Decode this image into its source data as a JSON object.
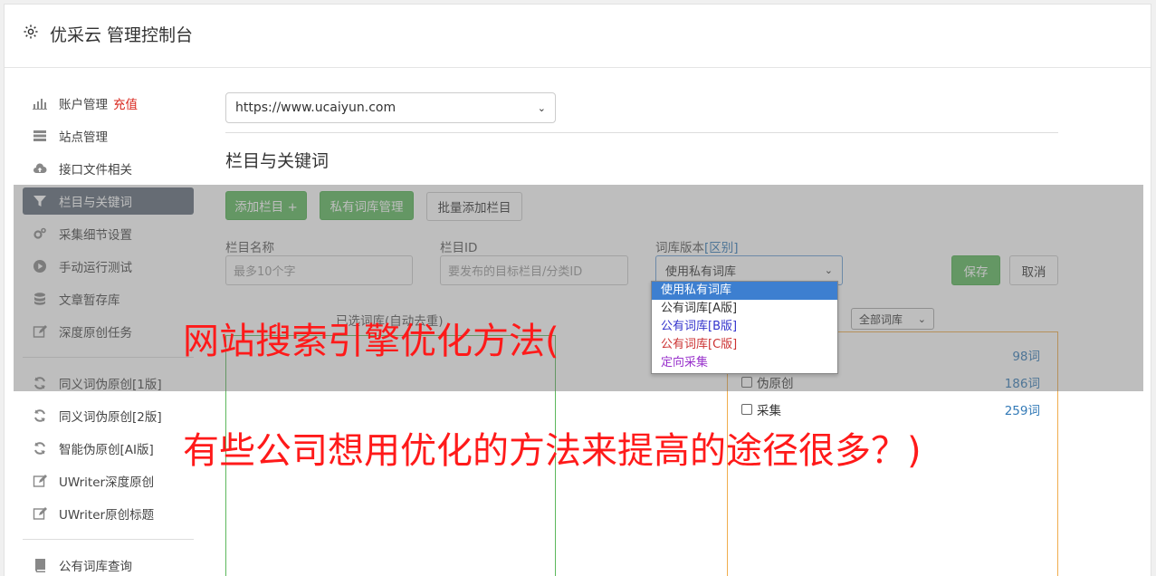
{
  "header": {
    "title": "优采云 管理控制台",
    "icon": "gear-icon"
  },
  "sidebar": {
    "items": [
      {
        "label": "账户管理",
        "extra": "充值",
        "icon": "bar-chart-icon"
      },
      {
        "label": "站点管理",
        "icon": "server-icon"
      },
      {
        "label": "接口文件相关",
        "icon": "cloud-upload-icon"
      },
      {
        "label": "栏目与关键词",
        "icon": "filter-icon",
        "active": true
      },
      {
        "label": "采集细节设置",
        "icon": "cogs-icon"
      },
      {
        "label": "手动运行测试",
        "icon": "play-circle-icon"
      },
      {
        "label": "文章暂存库",
        "icon": "database-icon"
      },
      {
        "label": "深度原创任务",
        "icon": "edit-icon"
      },
      {
        "label": "同义词伪原创[1版]",
        "icon": "refresh-icon"
      },
      {
        "label": "同义词伪原创[2版]",
        "icon": "refresh-icon"
      },
      {
        "label": "智能伪原创[AI版]",
        "icon": "refresh-icon"
      },
      {
        "label": "UWriter深度原创",
        "icon": "edit-icon"
      },
      {
        "label": "UWriter原创标题",
        "icon": "edit-icon"
      },
      {
        "label": "公有词库查询",
        "icon": "book-icon"
      }
    ]
  },
  "main": {
    "site_select_value": "https://www.ucaiyun.com",
    "section_title": "栏目与关键词",
    "buttons": {
      "add_column": "添加栏目 +",
      "private_lib": "私有词库管理",
      "batch_add": "批量添加栏目",
      "save": "保存",
      "cancel": "取消"
    },
    "form": {
      "name_label": "栏目名称",
      "name_placeholder": "最多10个字",
      "id_label": "栏目ID",
      "id_placeholder": "要发布的目标栏目/分类ID",
      "version_label": "词库版本",
      "version_link": "[区别]",
      "version_value": "使用私有词库"
    },
    "dropdown_options": [
      {
        "label": "使用私有词库",
        "color": "#ffffff"
      },
      {
        "label": "公有词库[A版]",
        "color": "#333333"
      },
      {
        "label": "公有词库[B版]",
        "color": "#3333cc"
      },
      {
        "label": "公有词库[C版]",
        "color": "#cc3333"
      },
      {
        "label": "定向采集",
        "color": "#9933cc"
      }
    ],
    "selected_label": "已选词库(自动去重)",
    "lib_filter_value": "全部词库",
    "libraries": [
      {
        "label": "",
        "count": "98词"
      },
      {
        "label": "伪原创",
        "count": "186词"
      },
      {
        "label": "采集",
        "count": "259词"
      }
    ]
  },
  "overlay_text": {
    "line1": "网站搜索引擎优化方法(",
    "line2": "有些公司想用优化的方法来提高的途径很多？)"
  },
  "colors": {
    "accent_green": "#5cb85c",
    "active_nav": "#5f6b78",
    "overlay_red": "#ff1a1a",
    "link_blue": "#337ab7"
  }
}
